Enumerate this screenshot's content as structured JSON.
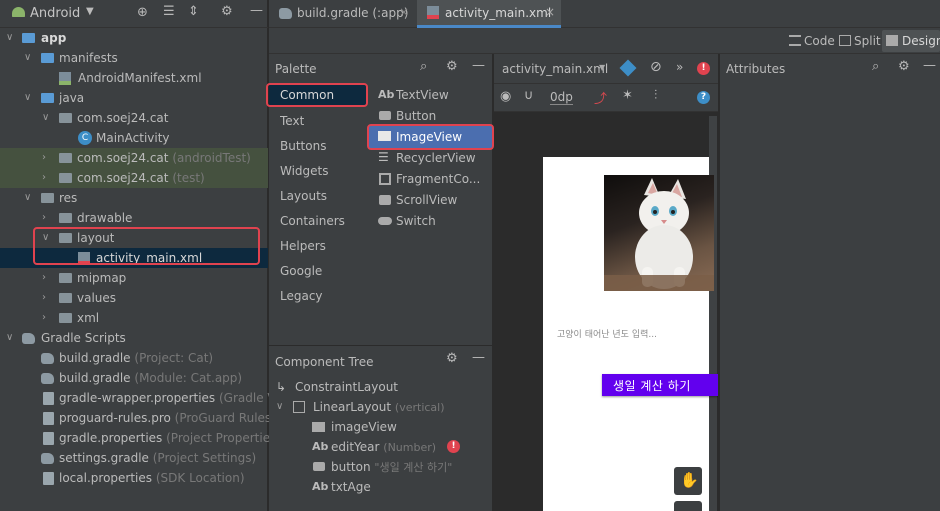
{
  "project": {
    "view_selector": "Android",
    "tree": [
      {
        "label": "app",
        "bold": true
      },
      {
        "label": "manifests"
      },
      {
        "label": "AndroidManifest.xml"
      },
      {
        "label": "java"
      },
      {
        "label": "com.soej24.cat"
      },
      {
        "label": "MainActivity"
      },
      {
        "label": "com.soej24.cat",
        "suffix": "(androidTest)"
      },
      {
        "label": "com.soej24.cat",
        "suffix": "(test)"
      },
      {
        "label": "res"
      },
      {
        "label": "drawable"
      },
      {
        "label": "layout"
      },
      {
        "label": "activity_main.xml"
      },
      {
        "label": "mipmap"
      },
      {
        "label": "values"
      },
      {
        "label": "xml"
      },
      {
        "label": "Gradle Scripts"
      },
      {
        "label": "build.gradle",
        "suffix": "(Project: Cat)"
      },
      {
        "label": "build.gradle",
        "suffix": "(Module: Cat.app)"
      },
      {
        "label": "gradle-wrapper.properties",
        "suffix": "(Gradle Versi"
      },
      {
        "label": "proguard-rules.pro",
        "suffix": "(ProGuard Rules for"
      },
      {
        "label": "gradle.properties",
        "suffix": "(Project Properties)"
      },
      {
        "label": "settings.gradle",
        "suffix": "(Project Settings)"
      },
      {
        "label": "local.properties",
        "suffix": "(SDK Location)"
      }
    ]
  },
  "tabs": [
    {
      "label": "build.gradle (:app)"
    },
    {
      "label": "activity_main.xml",
      "active": true
    }
  ],
  "view_modes": {
    "code": "Code",
    "split": "Split",
    "design": "Design"
  },
  "palette": {
    "title": "Palette",
    "categories": [
      "Common",
      "Text",
      "Buttons",
      "Widgets",
      "Layouts",
      "Containers",
      "Helpers",
      "Google",
      "Legacy"
    ],
    "widgets": [
      {
        "icon": "Ab",
        "label": "TextView"
      },
      {
        "icon": "btn",
        "label": "Button"
      },
      {
        "icon": "img",
        "label": "ImageView",
        "selected": true
      },
      {
        "icon": "list",
        "label": "RecyclerView"
      },
      {
        "icon": "frag",
        "label": "FragmentCo..."
      },
      {
        "icon": "scroll",
        "label": "ScrollView"
      },
      {
        "icon": "switch",
        "label": "Switch"
      }
    ]
  },
  "editor": {
    "file_selector": "activity_main.xml",
    "margin": "0dp"
  },
  "attributes": {
    "title": "Attributes"
  },
  "component_tree": {
    "title": "Component Tree",
    "nodes": [
      {
        "label": "ConstraintLayout"
      },
      {
        "label": "LinearLayout",
        "suffix": "(vertical)"
      },
      {
        "label": "imageView"
      },
      {
        "label": "editYear",
        "suffix": "(Number)"
      },
      {
        "label": "button",
        "suffix": "\"생일 계산 하기\""
      },
      {
        "label": "txtAge"
      }
    ]
  },
  "preview": {
    "hint": "고양이 태어난 년도 입력...",
    "button": "생일 계산 하기"
  },
  "colors": {
    "accent": "#6200ee",
    "highlight": "#e0434f",
    "selection": "#4b6eaf",
    "selected_row": "#0d293e"
  }
}
